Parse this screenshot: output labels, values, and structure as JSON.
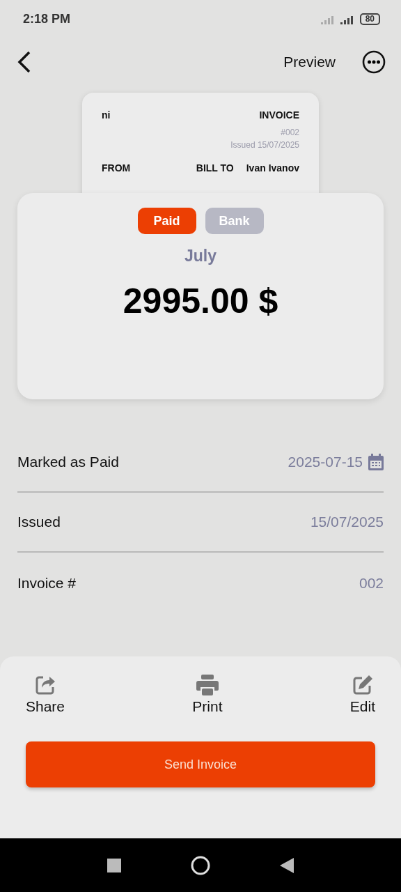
{
  "status_bar": {
    "time": "2:18 PM",
    "battery": "80"
  },
  "header": {
    "title": "Preview"
  },
  "invoice_preview": {
    "company": "ni",
    "heading": "INVOICE",
    "number": "#002",
    "issued": "Issued 15/07/2025",
    "from_label": "FROM",
    "bill_to_label": "BILL TO",
    "client": "Ivan Ivanov"
  },
  "summary": {
    "chips": [
      {
        "label": "Paid",
        "selected": true
      },
      {
        "label": "Bank",
        "selected": false
      }
    ],
    "month": "July",
    "amount": "2995.00 $"
  },
  "details": [
    {
      "label": "Marked as Paid",
      "value": "2025-07-15",
      "kind": "date"
    },
    {
      "label": "Issued",
      "value": "15/07/2025",
      "kind": "text"
    },
    {
      "label": "Invoice #",
      "value": "002",
      "kind": "text"
    }
  ],
  "actions": [
    {
      "label": "Share",
      "kind": "share"
    },
    {
      "label": "Print",
      "kind": "print"
    },
    {
      "label": "Edit",
      "kind": "edit"
    }
  ],
  "primary_button": "Send Invoice"
}
